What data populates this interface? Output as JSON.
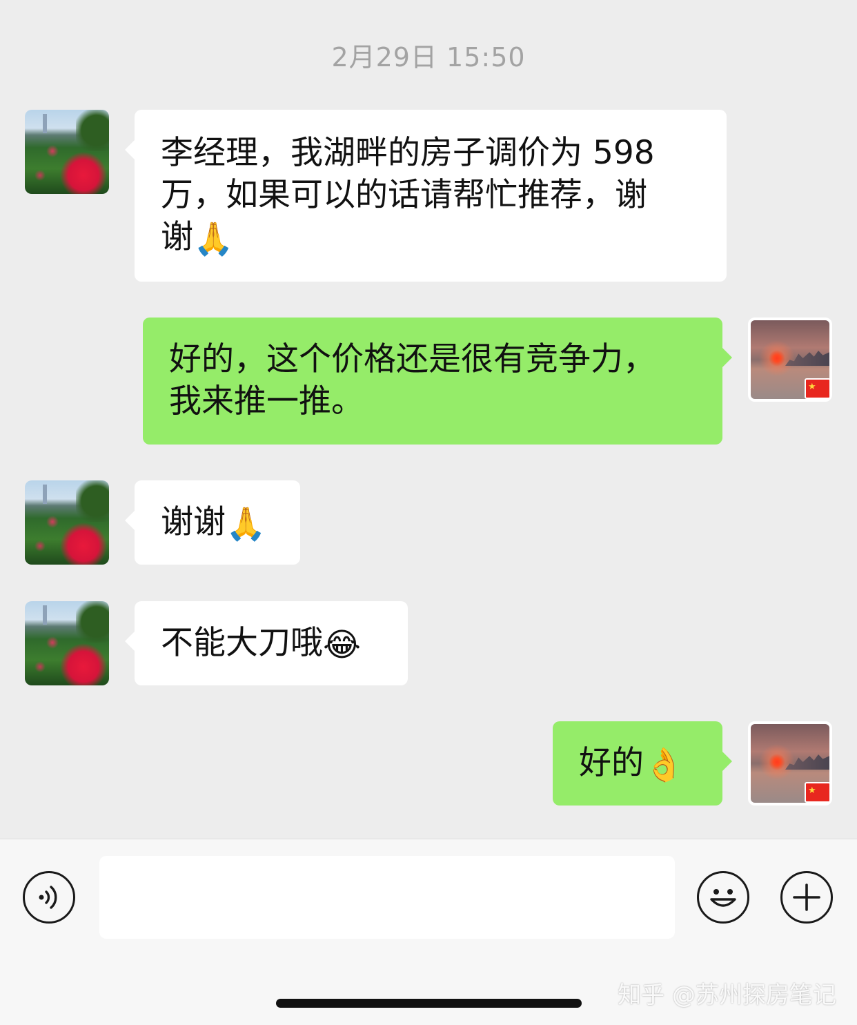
{
  "timestamp": "2月29日 15:50",
  "messages": [
    {
      "side": "left",
      "text": "李经理，我湖畔的房子调价为 598万，如果可以的话请帮忙推荐，谢谢",
      "emoji": "🙏"
    },
    {
      "side": "right",
      "text": "好的，这个价格还是很有竞争力，我来推一推。"
    },
    {
      "side": "left",
      "text": "谢谢",
      "emoji": "🙏"
    },
    {
      "side": "left",
      "text": "不能大刀哦",
      "emoji": "😂"
    },
    {
      "side": "right",
      "text": "好的",
      "emoji": "👌"
    }
  ],
  "message_lines": {
    "m1_line1": "李经理，我湖畔的房子调价为 598",
    "m1_line2": "万，如果可以的话请帮忙推荐，谢",
    "m1_line3": "谢",
    "m2_line1": "好的，这个价格还是很有竞争力，",
    "m2_line2": "我来推一推。"
  },
  "input": {
    "value": "",
    "placeholder": ""
  },
  "icons": {
    "voice": "voice-input-icon",
    "emoji": "emoji-smiley-icon",
    "plus": "plus-more-icon"
  },
  "watermark": "知乎 @苏州探房笔记",
  "colors": {
    "background": "#ededed",
    "bubble_incoming": "#ffffff",
    "bubble_outgoing": "#95ec69",
    "timestamp": "#a3a3a3"
  }
}
